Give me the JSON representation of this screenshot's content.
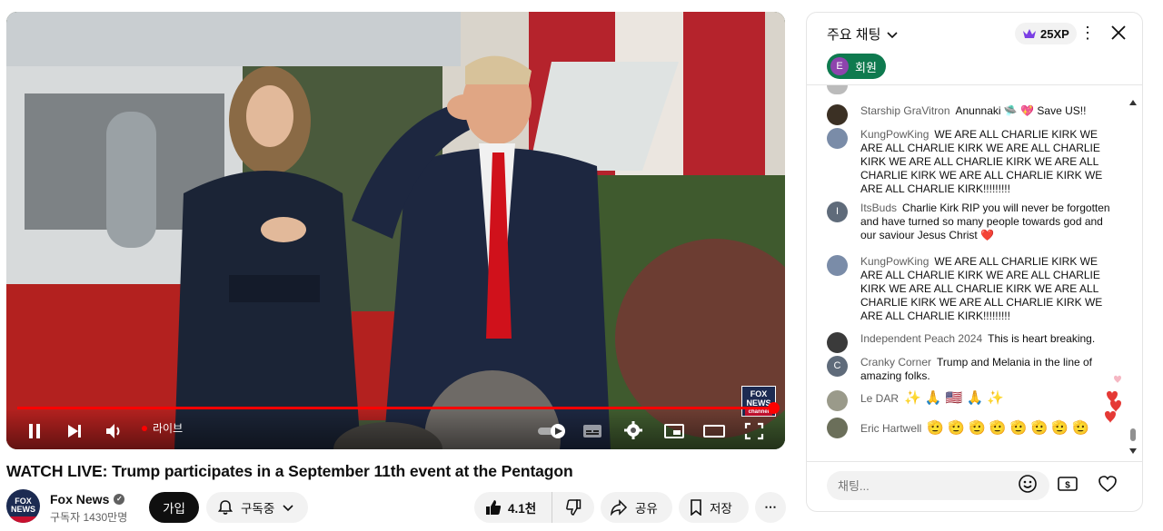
{
  "video": {
    "live_label": "라이브",
    "progress": 1.0,
    "bug_text": "FOX NEWS",
    "bug_sub": "channel"
  },
  "title": "WATCH LIVE: Trump participates in a September 11th event at the Pentagon",
  "channel": {
    "name": "Fox News",
    "subscribers": "구독자 1430만명",
    "avatar_text": "FOX NEWS",
    "verified_icon": "check-icon"
  },
  "actions": {
    "join": "가입",
    "subscribed": "구독중",
    "likes": "4.1천",
    "share": "공유",
    "save": "저장",
    "more": "⋯"
  },
  "chat": {
    "title": "주요 채팅",
    "xp": "25XP",
    "member_filter": "회원",
    "member_initial": "E",
    "input_placeholder": "채팅...",
    "messages": [
      {
        "author": "Starship GraVitron",
        "text": "Anunnaki 🛸 💖 Save US!!",
        "avatar_color": "#3b3024"
      },
      {
        "author": "KungPowKing",
        "text": "WE ARE ALL CHARLIE KIRK WE ARE ALL CHARLIE KIRK WE ARE ALL CHARLIE KIRK WE ARE ALL CHARLIE KIRK WE ARE ALL CHARLIE KIRK WE ARE ALL CHARLIE KIRK WE ARE ALL CHARLIE KIRK!!!!!!!!!",
        "avatar_color": "#7a8ca8"
      },
      {
        "author": "ItsBuds",
        "text": "Charlie Kirk RIP you will never be forgotten and have turned so many people towards god and our saviour Jesus Christ ❤️",
        "avatar_color": "#5f6b7a",
        "initial": "I"
      },
      {
        "author": "KungPowKing",
        "text": "WE ARE ALL CHARLIE KIRK WE ARE ALL CHARLIE KIRK WE ARE ALL CHARLIE KIRK WE ARE ALL CHARLIE KIRK WE ARE ALL CHARLIE KIRK WE ARE ALL CHARLIE KIRK WE ARE ALL CHARLIE KIRK!!!!!!!!!",
        "avatar_color": "#7a8ca8"
      },
      {
        "author": "Independent Peach 2024",
        "text": "This is heart breaking.",
        "avatar_color": "#3a3a3a"
      },
      {
        "author": "Cranky Corner",
        "text": "Trump and Melania in the line of amazing folks.",
        "avatar_color": "#5f6b7a",
        "initial": "C"
      },
      {
        "author": "Le DAR",
        "text": "✨ 🙏 🇺🇸 🙏 ✨",
        "avatar_color": "#9a9a8a"
      },
      {
        "author": "Eric Hartwell",
        "text": "🫡 🫡 🫡 🫡 🫡 🫡 🫡 🫡",
        "avatar_color": "#6b6f5a"
      }
    ]
  }
}
